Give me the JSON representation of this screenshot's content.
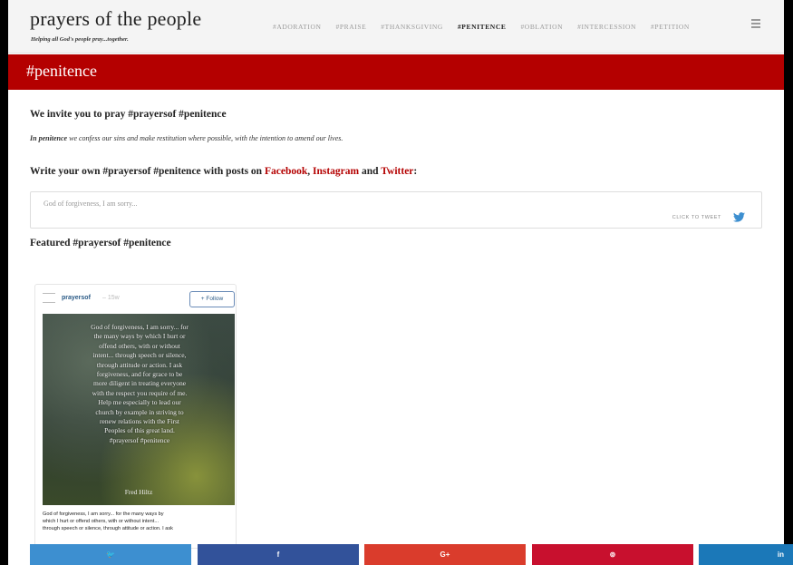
{
  "site": {
    "title": "prayers of the people",
    "tagline": "Helping all God's people pray...together."
  },
  "nav": {
    "items": [
      {
        "label": "#ADORATION"
      },
      {
        "label": "#PRAISE"
      },
      {
        "label": "#THANKSGIVING"
      },
      {
        "label": "#PENITENCE",
        "active": true
      },
      {
        "label": "#OBLATION"
      },
      {
        "label": "#INTERCESSION"
      },
      {
        "label": "#PETITION"
      }
    ],
    "menu_icon": "hamburger-menu-icon"
  },
  "banner": {
    "title": "#penitence",
    "color": "#b40000"
  },
  "invite": {
    "heading": "We invite you to pray #prayersof #penitence"
  },
  "description": {
    "lead": "In penitence",
    "text": " we confess our sins and make restitution where possible, with the intention to amend our lives."
  },
  "write": {
    "prefix": "Write your own #prayersof #penitence with posts on ",
    "facebook": "Facebook",
    "comma": ", ",
    "instagram": "Instagram",
    "and": " and ",
    "twitter": "Twitter",
    "colon": ":"
  },
  "tweet_box": {
    "text": "God of forgiveness, I am sorry...",
    "cta": "CLICK TO TWEET",
    "icon": "twitter-bird-icon"
  },
  "featured": {
    "heading": "Featured #prayersof #penitence"
  },
  "instagram_post": {
    "username": "prayersof",
    "age": "– 15w",
    "follow_label": "+ Follow",
    "image_text": "God of forgiveness, I am sorry... for\nthe many ways by which I hurt or\noffend others, with or without\nintent... through speech or silence,\nthrough attitude or action. I ask\nforgiveness, and for grace to be\nmore diligent in treating everyone\nwith the respect you require of me.\nHelp me especially to lead our\nchurch by example in striving to\nrenew relations with the First\nPeoples of this great land.\n#prayersof #penitence",
    "author": "Fred Hiltz",
    "caption": "God of forgiveness, I am sorry... for the many ways by\nwhich I hurt or offend others, with or without intent...\nthrough speech or silence, through attitude or action. I ask"
  },
  "share_bar": [
    {
      "network": "twitter",
      "icon": "twitter-icon",
      "glyph": "🐦",
      "color": "#3d8fd0"
    },
    {
      "network": "facebook",
      "icon": "facebook-icon",
      "glyph": "f",
      "color": "#32529a"
    },
    {
      "network": "google-plus",
      "icon": "google-plus-icon",
      "glyph": "G+",
      "color": "#da3c2c"
    },
    {
      "network": "pinterest",
      "icon": "pinterest-icon",
      "glyph": "⊚",
      "color": "#c8102e"
    },
    {
      "network": "linkedin",
      "icon": "linkedin-icon",
      "glyph": "in",
      "color": "#1b78b8"
    }
  ]
}
